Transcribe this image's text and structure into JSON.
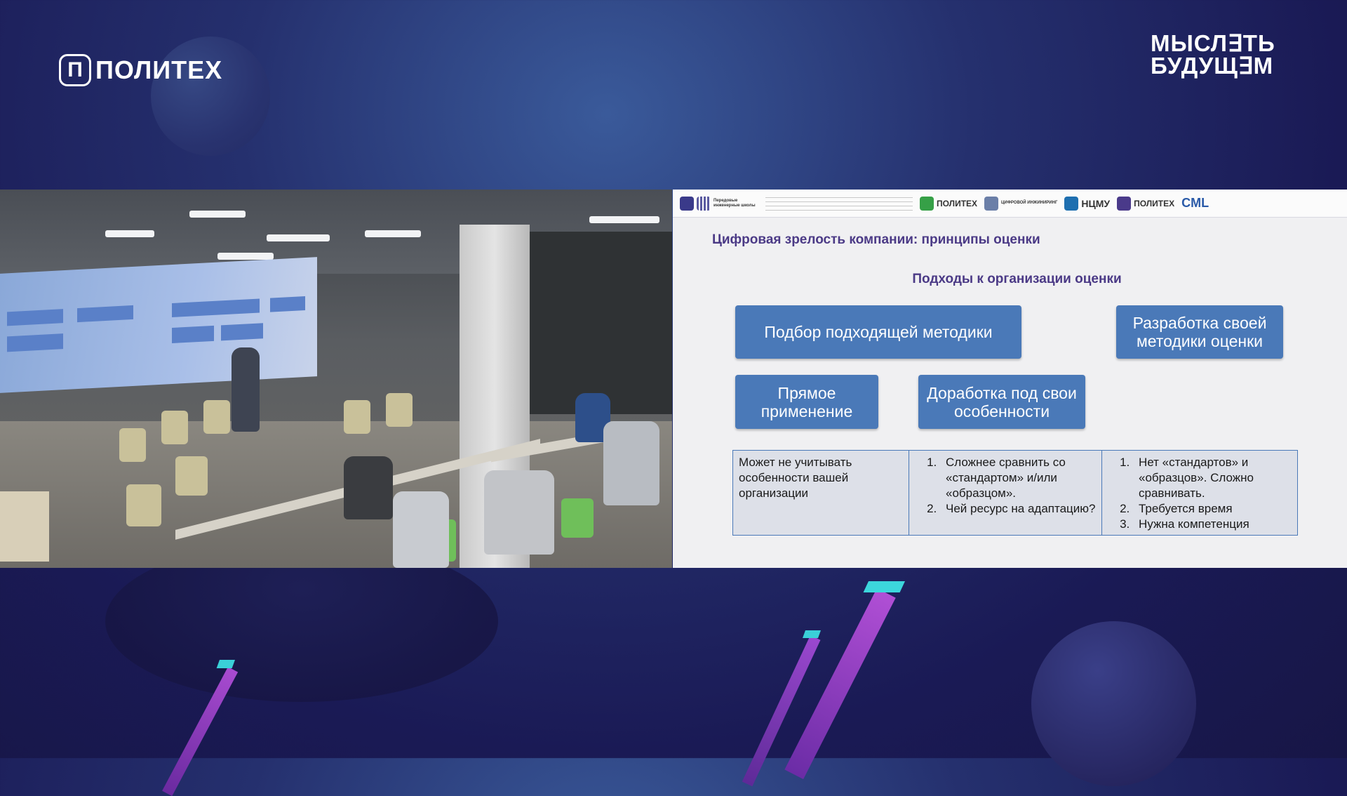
{
  "branding": {
    "left_logo_mark": "П",
    "left_logo_text": "ПОЛИТЕХ",
    "right_logo_line1": "МЫСЛ∃ТЬ",
    "right_logo_line2": "БУДУЩ∃М"
  },
  "slide": {
    "header_logos": [
      {
        "name": "Передовые инженерные школы",
        "text": "Передовые инженерные школы"
      },
      {
        "name": "Политех",
        "text": "ПОЛИТЕХ"
      },
      {
        "name": "Цифровой инжиниринг",
        "text": "ЦИФРОВОЙ ИНЖИНИРИНГ"
      },
      {
        "name": "НЦМУ",
        "text": "НЦМУ"
      },
      {
        "name": "Политех 2",
        "text": "ПОЛИТЕХ"
      },
      {
        "name": "CML",
        "text": "CML"
      }
    ],
    "title": "Цифровая зрелость компании: принципы оценки",
    "subtitle": "Подходы к организации оценки",
    "boxes": {
      "select_method": "Подбор подходящей методики",
      "develop_own": "Разработка своей методики оценки",
      "direct_use": "Прямое применение",
      "adapt": "Доработка под свои особенности"
    },
    "table": {
      "col1": "Может не учитывать особенности вашей организации",
      "col2": [
        "Сложнее сравнить со «стандартом» и/или «образцом».",
        "Чей ресурс на адаптацию?"
      ],
      "col3": [
        "Нет «стандартов» и «образцов». Сложно сравнивать.",
        "Требуется время",
        "Нужна компетенция"
      ]
    }
  }
}
